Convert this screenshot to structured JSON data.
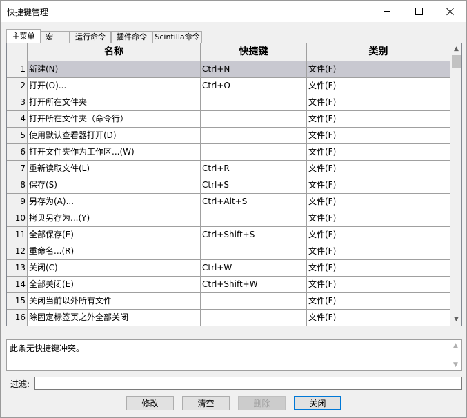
{
  "window": {
    "title": "快捷键管理"
  },
  "tabs": [
    {
      "label": "主菜单",
      "active": true
    },
    {
      "label": "宏"
    },
    {
      "label": "运行命令"
    },
    {
      "label": "插件命令"
    },
    {
      "label": "Scintilla命令"
    }
  ],
  "table": {
    "headers": [
      "名称",
      "快捷键",
      "类别"
    ],
    "rows": [
      {
        "num": "1",
        "name": "新建(N)",
        "shortcut": "Ctrl+N",
        "category": "文件(F)"
      },
      {
        "num": "2",
        "name": "打开(O)...",
        "shortcut": "Ctrl+O",
        "category": "文件(F)"
      },
      {
        "num": "3",
        "name": "打开所在文件夹",
        "shortcut": "",
        "category": "文件(F)"
      },
      {
        "num": "4",
        "name": "打开所在文件夹（命令行）",
        "shortcut": "",
        "category": "文件(F)"
      },
      {
        "num": "5",
        "name": "使用默认查看器打开(D)",
        "shortcut": "",
        "category": "文件(F)"
      },
      {
        "num": "6",
        "name": "打开文件夹作为工作区...(W)",
        "shortcut": "",
        "category": "文件(F)"
      },
      {
        "num": "7",
        "name": "重新读取文件(L)",
        "shortcut": "Ctrl+R",
        "category": "文件(F)"
      },
      {
        "num": "8",
        "name": "保存(S)",
        "shortcut": "Ctrl+S",
        "category": "文件(F)"
      },
      {
        "num": "9",
        "name": "另存为(A)...",
        "shortcut": "Ctrl+Alt+S",
        "category": "文件(F)"
      },
      {
        "num": "10",
        "name": "拷贝另存为...(Y)",
        "shortcut": "",
        "category": "文件(F)"
      },
      {
        "num": "11",
        "name": "全部保存(E)",
        "shortcut": "Ctrl+Shift+S",
        "category": "文件(F)"
      },
      {
        "num": "12",
        "name": "重命名...(R)",
        "shortcut": "",
        "category": "文件(F)"
      },
      {
        "num": "13",
        "name": "关闭(C)",
        "shortcut": "Ctrl+W",
        "category": "文件(F)"
      },
      {
        "num": "14",
        "name": "全部关闭(E)",
        "shortcut": "Ctrl+Shift+W",
        "category": "文件(F)"
      },
      {
        "num": "15",
        "name": "关闭当前以外所有文件",
        "shortcut": "",
        "category": "文件(F)"
      },
      {
        "num": "16",
        "name": "除固定标签页之外全部关闭",
        "shortcut": "",
        "category": "文件(F)"
      }
    ],
    "selected_row": 0
  },
  "message": {
    "text": "此条无快捷键冲突。"
  },
  "filter": {
    "label": "过滤:",
    "value": ""
  },
  "buttons": {
    "modify": "修改",
    "clear": "清空",
    "delete": "删除",
    "close": "关闭"
  }
}
